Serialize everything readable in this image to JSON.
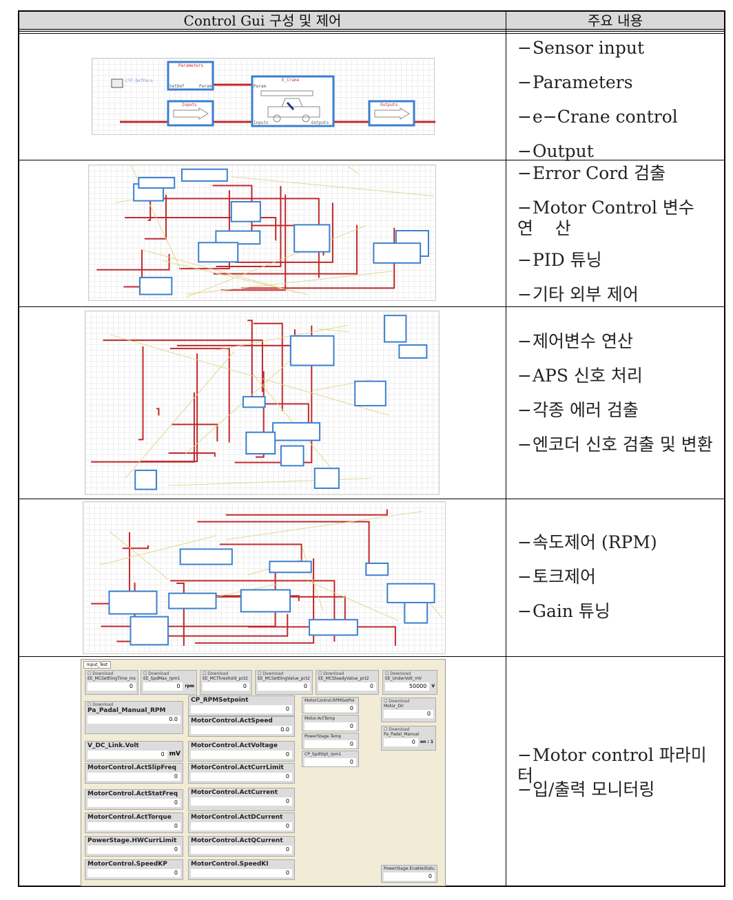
{
  "header": {
    "col1": "Control Gui 구성 및 제어",
    "col2": "주요 내용"
  },
  "rows": [
    {
      "items": [
        "Sensor input",
        "Parameters",
        "e−Crane control",
        "Output"
      ]
    },
    {
      "items": [
        "Error Cord 검출",
        "Motor Control 변수 연    산",
        "PID 튜닝",
        "기타 외부 제어"
      ]
    },
    {
      "items": [
        "제어변수 연산",
        "APS 신호 처리",
        "각종 에러 검출",
        "엔코더 신호 검출 및 변환"
      ]
    },
    {
      "items": [
        "속도제어 (RPM)",
        "토크제어",
        "Gain 튜닝"
      ]
    },
    {
      "items": [
        "Motor control 파라미터",
        "입/출력 모니터링"
      ]
    }
  ],
  "diagram1": {
    "parameters": "Parameters",
    "setdef": "SetDef",
    "param": "Param",
    "ecrane": "E_Crane",
    "inputs": "Inputs",
    "outputs": "Outputs",
    "const": "CTP_DefPara"
  },
  "colors": {
    "wire": "#c0282c",
    "block": "#3a7fd0",
    "header_bg": "#d9d9d9",
    "panel_bg": "#f2ecd6"
  },
  "gui": {
    "tab": "Input_Test",
    "top": [
      {
        "label": "EE_MCSettlingTime_ms",
        "value": "0",
        "unit": ""
      },
      {
        "label": "EE_SpdMax_rpm1",
        "value": "0",
        "unit": "rpm"
      },
      {
        "label": "EE_MCThreshold_pct2",
        "value": "0",
        "unit": ""
      },
      {
        "label": "EE_MCSettlingValue_pct2",
        "value": "0",
        "unit": ""
      },
      {
        "label": "EE_MCSteadyValue_pct2",
        "value": "0",
        "unit": ""
      },
      {
        "label": "EE_UnderVolt_mV",
        "value": "50000",
        "unit": "V"
      }
    ],
    "download": "Download",
    "left": [
      {
        "label": "Pa_Padal_Manual_RPM",
        "value": "0.0"
      },
      {
        "label": "V_DC_Link.Volt",
        "value": "0",
        "unit": "mV"
      },
      {
        "label": "MotorControl.ActSlipFreq",
        "value": "0"
      },
      {
        "label": "MotorControl.ActStatFreq",
        "value": "0"
      },
      {
        "label": "MotorControl.ActTorque",
        "value": "0"
      },
      {
        "label": "PowerStage.HWCurrLimit",
        "value": "0"
      },
      {
        "label": "MotorControl.SpeedKP",
        "value": "0"
      }
    ],
    "mid": [
      {
        "label": "CP_RPMSetpoint",
        "value": "0"
      },
      {
        "label": "MotorControl.ActSpeed",
        "value": "0.0"
      },
      {
        "label": "MotorControl.ActVoltage",
        "value": "0"
      },
      {
        "label": "MotorControl.ActCurrLimit",
        "value": "0"
      },
      {
        "label": "MotorControl.ActCurrent",
        "value": "0"
      },
      {
        "label": "MotorControl.ActDCurrent",
        "value": "0"
      },
      {
        "label": "MotorControl.ActQCurrent",
        "value": "0"
      },
      {
        "label": "MotorControl.SpeedKI",
        "value": "0"
      }
    ],
    "small": [
      {
        "label": "MotorControl.RPMSetPoi",
        "value": "0"
      },
      {
        "label": "Motor.ActTemp",
        "value": "0"
      },
      {
        "label": "PowerStage.Temp",
        "value": "0"
      },
      {
        "label": "CP_SpdStpt_rpm1",
        "value": "0"
      }
    ],
    "right": [
      {
        "label": "Motor_Dir",
        "value": "0",
        "unit": ""
      },
      {
        "label": "Pa_Padal_Manual",
        "value": "0",
        "unit": "on : 1"
      },
      {
        "label": "PowerStage.EnableStatus",
        "value": "0",
        "unit": ""
      }
    ]
  }
}
